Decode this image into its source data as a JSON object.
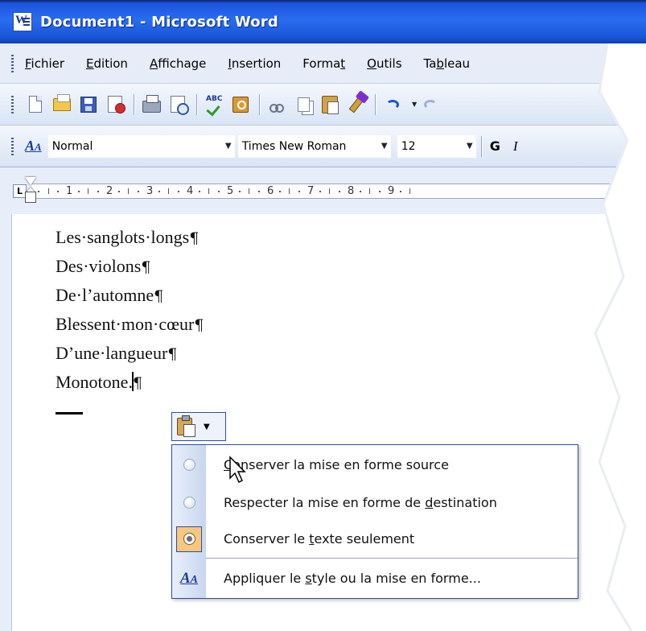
{
  "window": {
    "title": "Document1 - Microsoft Word"
  },
  "menubar": {
    "items": [
      {
        "pre": "",
        "acc": "F",
        "post": "ichier"
      },
      {
        "pre": "",
        "acc": "E",
        "post": "dition"
      },
      {
        "pre": "",
        "acc": "A",
        "post": "ffichage"
      },
      {
        "pre": "",
        "acc": "I",
        "post": "nsertion"
      },
      {
        "pre": "Forma",
        "acc": "t",
        "post": ""
      },
      {
        "pre": "",
        "acc": "O",
        "post": "utils"
      },
      {
        "pre": "Ta",
        "acc": "b",
        "post": "leau"
      }
    ]
  },
  "formatting": {
    "style": "Normal",
    "font": "Times New Roman",
    "size": "12",
    "bold_label": "G",
    "italic_label": "I"
  },
  "ruler": {
    "numbers": [
      "1",
      "2",
      "3",
      "4",
      "5",
      "6",
      "7",
      "8",
      "9"
    ]
  },
  "document": {
    "lines": [
      "Les·sanglots·longs",
      "Des·violons",
      "De·l’automne",
      "Blessent·mon·cœur",
      "D’une·langueur",
      "Monotone."
    ],
    "pilcrow": "¶"
  },
  "paste_options": {
    "items": [
      {
        "pre": "",
        "acc": "C",
        "post": "onserver la mise en forme source",
        "icon": "radio",
        "selected": false
      },
      {
        "pre": "Respecter la mise en forme de ",
        "acc": "d",
        "post": "estination",
        "icon": "radio",
        "selected": false
      },
      {
        "pre": "Conserver le ",
        "acc": "t",
        "post": "exte seulement",
        "icon": "radio",
        "selected": true
      },
      {
        "pre": "Appliquer le ",
        "acc": "s",
        "post": "tyle ou la mise en forme...",
        "icon": "style-icon",
        "selected": false
      }
    ]
  },
  "colors": {
    "titlebar": "#2a6cf0",
    "menubar": "#e6ecf8",
    "highlight": "#f9c67e",
    "border": "#314f99"
  }
}
